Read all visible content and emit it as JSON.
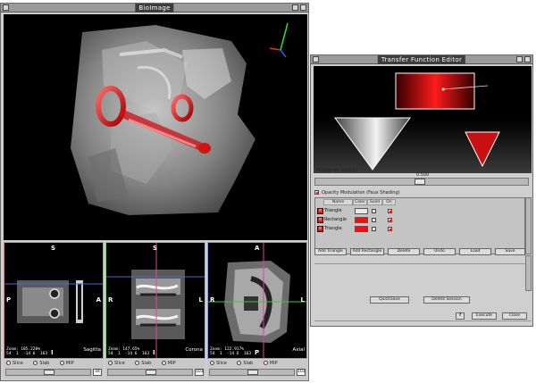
{
  "bio": {
    "title": "BioImage",
    "views": {
      "sagittal": {
        "top": "S",
        "left": "P",
        "right": "A",
        "bottom": "I",
        "name": "Sagitta",
        "info": "Zoom: 105.220%\n54  1  -14 6  163"
      },
      "coronal": {
        "top": "S",
        "left": "R",
        "right": "L",
        "bottom": "I",
        "name": "Corona",
        "info": "Zoom: 147.65%\n54  1  -14 6  163"
      },
      "axial": {
        "top": "A",
        "left": "R",
        "right": "L",
        "bottom": "P",
        "name": "Axial",
        "info": "Zoom: 122.917%\n54  1  -14 6  163"
      }
    },
    "controls": {
      "radio_slice": "Slice",
      "radio_slab": "Slab",
      "radio_mip": "MIP",
      "sag_num": "34",
      "cor_num": "103",
      "ax_num": "103"
    }
  },
  "tfe": {
    "title": "Transfer Function Editor",
    "histogram_opacity_label": "Histogram Opacity",
    "opacity_value": "0.500",
    "opacity_modulation_label": "Opacity Modulation (Faux Shading)",
    "headers": {
      "name": "Name",
      "color": "Color",
      "solid": "Solid",
      "on": "On"
    },
    "widgets": [
      {
        "name": "Triangle",
        "color": "#e8e8e8"
      },
      {
        "name": "Rectangle",
        "color": "#e01818"
      },
      {
        "name": "Triangle",
        "color": "#f01010"
      }
    ],
    "buttons": {
      "add_triangle": "Add Triangle",
      "add_rectangle": "Add Rectangle",
      "delete": "Delete",
      "undo": "Undo",
      "load": "Load",
      "save": "Save",
      "quicksave": "QuickSave",
      "delete_session": "Delete Session",
      "help": "?",
      "execute": "Execute",
      "close": "Close"
    }
  }
}
